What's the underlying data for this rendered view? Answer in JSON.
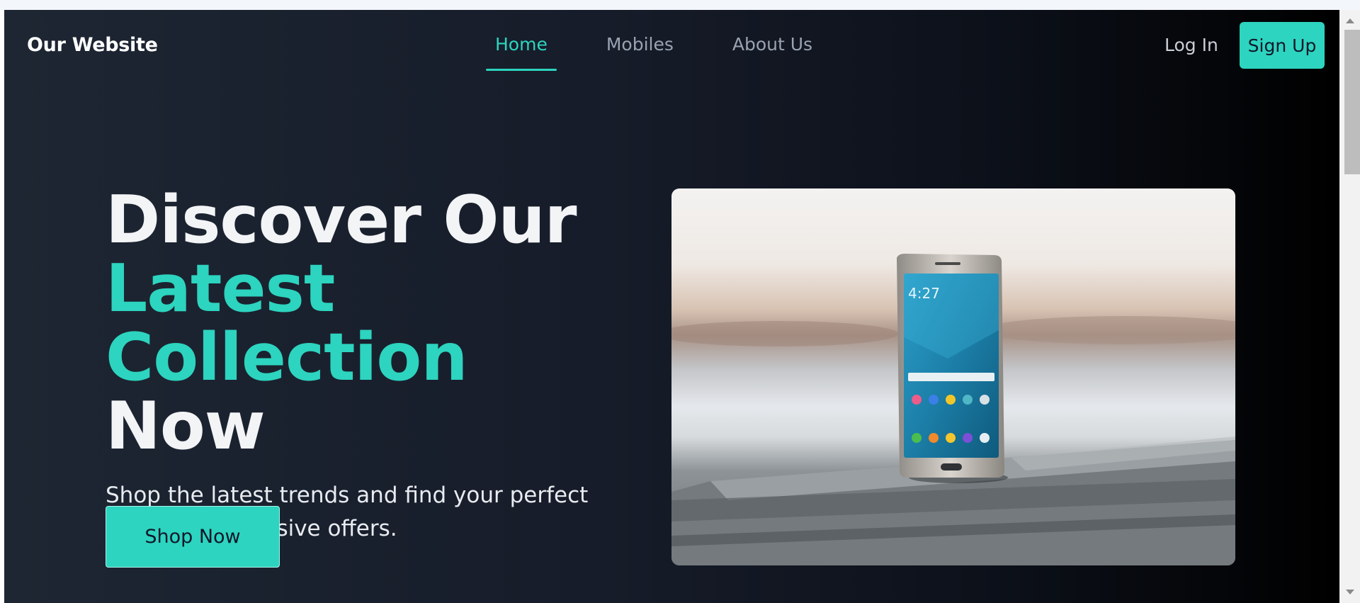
{
  "brand": {
    "name": "Our Website"
  },
  "nav": {
    "links": [
      {
        "label": "Home",
        "active": true
      },
      {
        "label": "Mobiles",
        "active": false
      },
      {
        "label": "About Us",
        "active": false
      }
    ],
    "login_label": "Log In",
    "signup_label": "Sign Up"
  },
  "hero": {
    "title_line1": "Discover Our",
    "title_accent": "Latest Collection",
    "title_end": "Now",
    "subtitle": "Shop the latest trends and find your perfect style with exclusive offers.",
    "cta_label": "Shop Now",
    "image": {
      "subject": "smartphone-on-wooden-table",
      "phone_time": "4:27"
    }
  },
  "colors": {
    "accent": "#2dd4bf",
    "background_start": "#1e2633",
    "background_end": "#000000",
    "text": "#f3f4f6",
    "muted": "#9aa3b2"
  }
}
